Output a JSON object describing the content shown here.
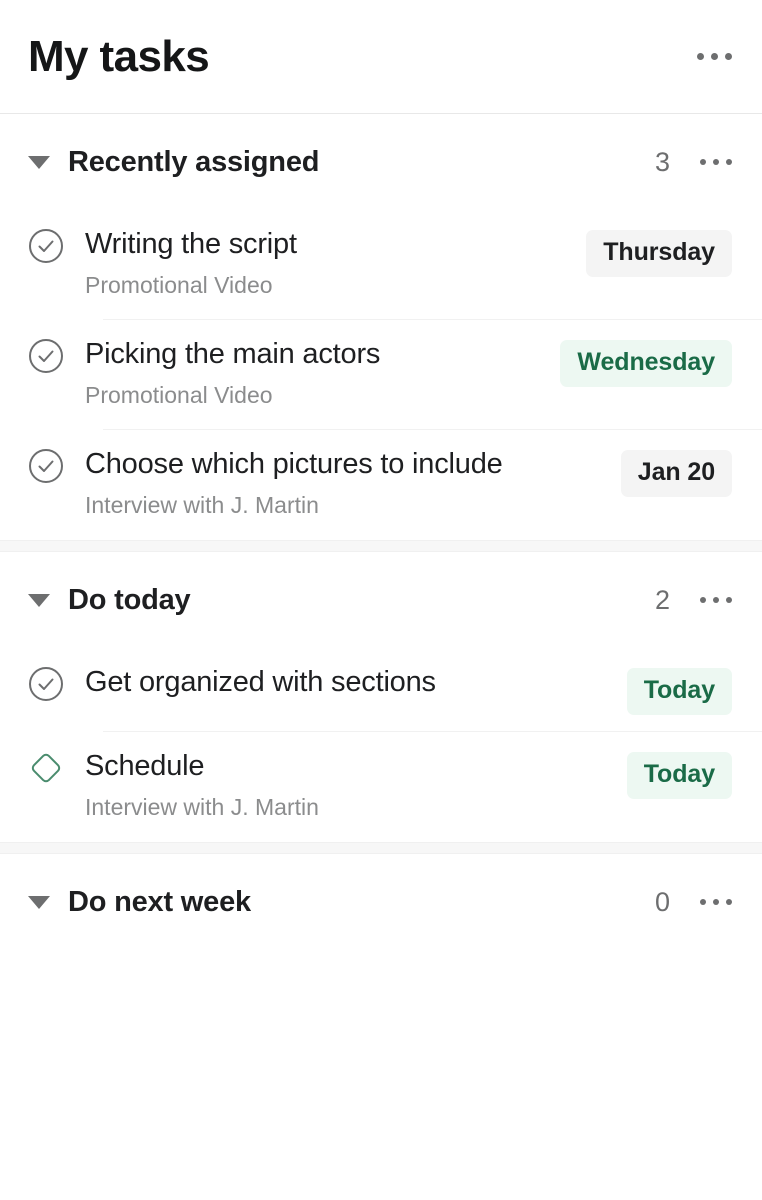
{
  "header": {
    "title": "My tasks",
    "menu_icon": "ellipsis-icon"
  },
  "colors": {
    "text_primary": "#1e1f21",
    "text_muted": "#8b8c8d",
    "chip_neutral_bg": "#f4f4f4",
    "chip_green_bg": "#edf8f2",
    "chip_green_text": "#1a6b47",
    "milestone_green": "#4a8c6e",
    "divider": "#f1f1f1",
    "section_band": "#f7f7f7"
  },
  "sections": [
    {
      "id": "recently-assigned",
      "title": "Recently assigned",
      "count": "3",
      "caret_icon": "caret-down-icon",
      "menu_icon": "ellipsis-icon",
      "tasks": [
        {
          "title": "Writing the script",
          "subtitle": "Promotional Video",
          "icon": "circle-check-icon",
          "due": "Thursday",
          "due_style": "neutral"
        },
        {
          "title": "Picking the main actors",
          "subtitle": "Promotional Video",
          "icon": "circle-check-icon",
          "due": "Wednesday",
          "due_style": "green"
        },
        {
          "title": "Choose which pictures to include",
          "subtitle": "Interview with J. Martin",
          "icon": "circle-check-icon",
          "due": "Jan 20",
          "due_style": "neutral"
        }
      ]
    },
    {
      "id": "do-today",
      "title": "Do today",
      "count": "2",
      "caret_icon": "caret-down-icon",
      "menu_icon": "ellipsis-icon",
      "tasks": [
        {
          "title": "Get organized with sections",
          "subtitle": "",
          "icon": "circle-check-icon",
          "due": "Today",
          "due_style": "green"
        },
        {
          "title": "Schedule",
          "subtitle": "Interview with J. Martin",
          "icon": "milestone-diamond-icon",
          "due": "Today",
          "due_style": "green"
        }
      ]
    },
    {
      "id": "do-next-week",
      "title": "Do next week",
      "count": "0",
      "caret_icon": "caret-down-icon",
      "menu_icon": "ellipsis-icon",
      "tasks": []
    }
  ]
}
